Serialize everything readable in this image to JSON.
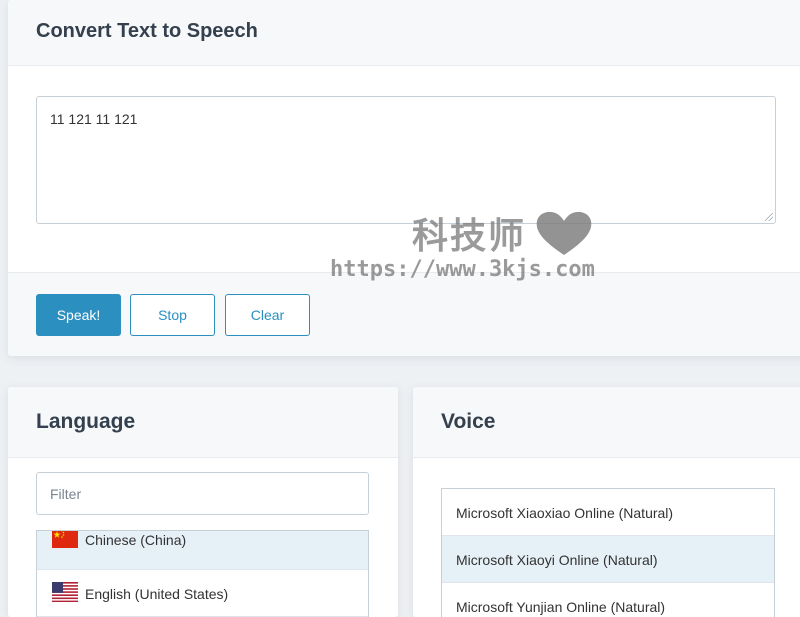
{
  "tts": {
    "title": "Convert Text to Speech",
    "text_value": "11 121 11 121",
    "buttons": {
      "speak": "Speak!",
      "stop": "Stop",
      "clear": "Clear"
    }
  },
  "language": {
    "title": "Language",
    "filter_placeholder": "Filter",
    "items": [
      {
        "label": "Chinese (China)",
        "flag": "cn-flag-icon",
        "selected": true
      },
      {
        "label": "English (United States)",
        "flag": "us-flag-icon",
        "selected": false
      }
    ]
  },
  "voice": {
    "title": "Voice",
    "items": [
      {
        "label": "Microsoft Xiaoxiao Online (Natural)",
        "selected": false
      },
      {
        "label": "Microsoft Xiaoyi Online (Natural)",
        "selected": true
      },
      {
        "label": "Microsoft Yunjian Online (Natural)",
        "selected": false
      }
    ]
  },
  "watermark": {
    "chinese": "科技师",
    "url": "https://www.3kjs.com",
    "icon": "heart-icon"
  },
  "colors": {
    "accent": "#2b8fc0",
    "selected_row": "#e6f0f7",
    "header_bg": "#f6f8fa"
  }
}
